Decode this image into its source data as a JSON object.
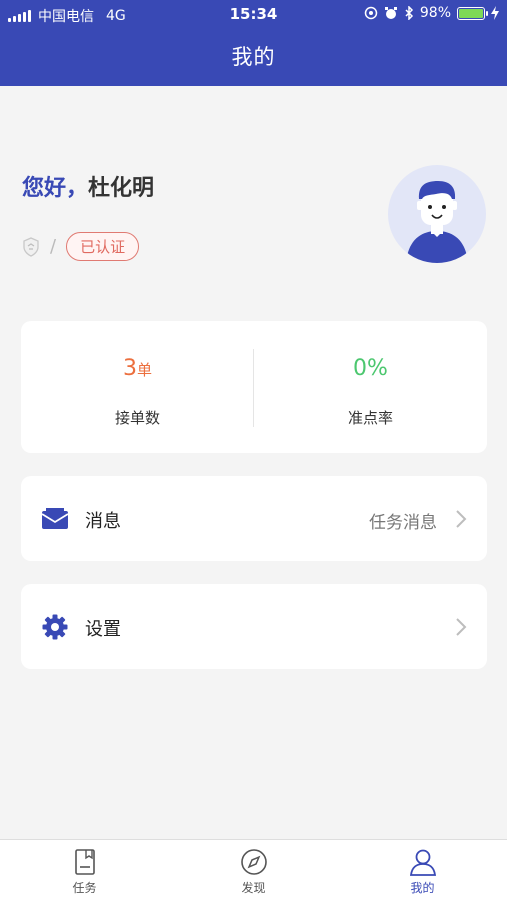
{
  "status_bar": {
    "carrier": "中国电信",
    "network": "4G",
    "time": "15:34",
    "battery": "98%"
  },
  "header": {
    "title": "我的"
  },
  "profile": {
    "greeting": "您好，",
    "name": "杜化明",
    "slash": "/",
    "verified_label": "已认证"
  },
  "stats": {
    "orders_value": "3",
    "orders_unit": "单",
    "orders_label": "接单数",
    "punctuality_value": "0%",
    "punctuality_label": "准点率"
  },
  "menu": {
    "messages_label": "消息",
    "messages_detail": "任务消息",
    "settings_label": "设置"
  },
  "tabbar": {
    "tasks_label": "任务",
    "discover_label": "发现",
    "mine_label": "我的"
  },
  "colors": {
    "primary": "#3949b5",
    "accent_orange": "#ec6f3e",
    "accent_green": "#4cc76f",
    "verified_red": "#e06a60"
  },
  "icons": [
    "signal-icon",
    "alarm-icon",
    "bluetooth-icon",
    "battery-icon",
    "shield-icon",
    "mail-icon",
    "gear-icon",
    "chevron-right-icon",
    "task-icon",
    "compass-icon",
    "person-icon"
  ]
}
